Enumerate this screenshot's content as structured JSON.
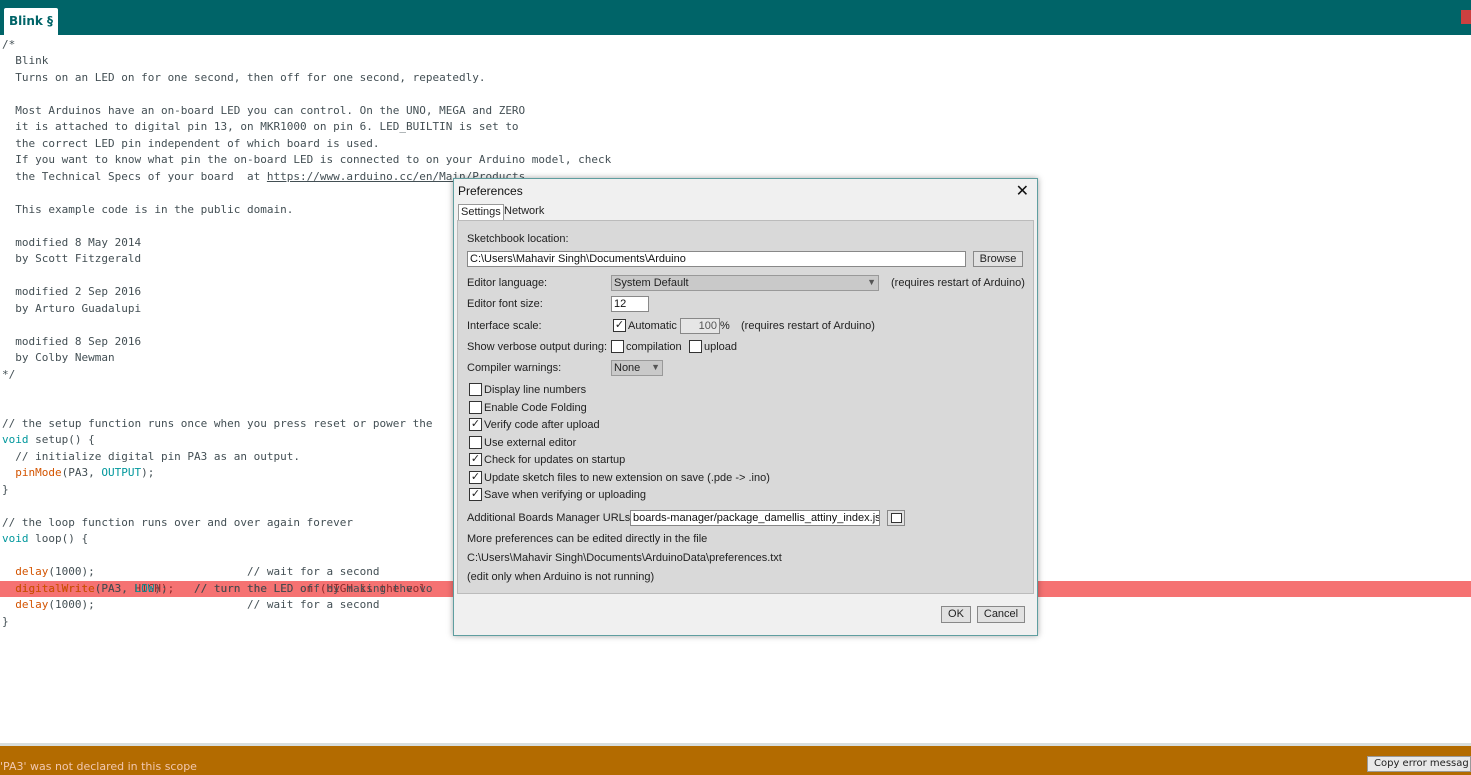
{
  "tab": {
    "label": "Blink §"
  },
  "code_lines": [
    "/*",
    "  Blink",
    "  Turns on an LED on for one second, then off for one second, repeatedly.",
    "",
    "  Most Arduinos have an on-board LED you can control. On the UNO, MEGA and ZERO",
    "  it is attached to digital pin 13, on MKR1000 on pin 6. LED_BUILTIN is set to",
    "  the correct LED pin independent of which board is used.",
    "  If you want to know what pin the on-board LED is connected to on your Arduino model, check",
    "  the Technical Specs of your board  at ",
    "",
    "  This example code is in the public domain.",
    "",
    "  modified 8 May 2014",
    "  by Scott Fitzgerald",
    "",
    "  modified 2 Sep 2016",
    "  by Arturo Guadalupi",
    "",
    "  modified 8 Sep 2016",
    "  by Colby Newman",
    "*/",
    "",
    "",
    "// the setup function runs once when you press reset or power the",
    "",
    "  // initialize digital pin PA3 as an output.",
    "",
    "}",
    "",
    "// the loop function runs over and over again forever",
    ""
  ],
  "code_url": "https://www.arduino.cc/en/Main/Products",
  "code_tokens": {
    "void": "void",
    "setup": " setup() {",
    "pinMode": "pinMode",
    "pinMode_args_1": "(PA3, ",
    "OUTPUT": "OUTPUT",
    "pinMode_args_2": ");",
    "loop": " loop() {",
    "dw_hl": "  digitalWrite(PA3, HIGH);   // turn the LED on (HIGH is the vol",
    "delay": "delay",
    "delay_arg_1": "(1000);                       // wait for a second",
    "digitalWrite": "digitalWrite",
    "dw_args_1": "(PA3, ",
    "LOW": "LOW",
    "dw_args_2": ");    // turn the LED off by making the vo",
    "delay_arg_2": "(1000);                       // wait for a second",
    "close_brace": "}"
  },
  "status": {
    "message": "'PA3' was not declared in this scope",
    "copy_button": "Copy error messag"
  },
  "dialog": {
    "title": "Preferences",
    "close": "✕",
    "tabs": [
      "Settings",
      "Network"
    ],
    "sketchbook_label": "Sketchbook location:",
    "sketchbook_value": "C:\\Users\\Mahavir Singh\\Documents\\Arduino",
    "browse": "Browse",
    "editor_language_label": "Editor language:",
    "editor_language_value": "System Default",
    "editor_language_note": "(requires restart of Arduino)",
    "font_size_label": "Editor font size:",
    "font_size_value": "12",
    "interface_scale_label": "Interface scale:",
    "automatic": "Automatic",
    "scale_value": "100",
    "percent": "%",
    "scale_note": "(requires restart of Arduino)",
    "verbose_label": "Show verbose output during:",
    "compilation": "compilation",
    "upload": "upload",
    "warnings_label": "Compiler warnings:",
    "warnings_value": "None",
    "checkboxes": [
      {
        "label": "Display line numbers",
        "checked": false
      },
      {
        "label": "Enable Code Folding",
        "checked": false
      },
      {
        "label": "Verify code after upload",
        "checked": true
      },
      {
        "label": "Use external editor",
        "checked": false
      },
      {
        "label": "Check for updates on startup",
        "checked": true
      },
      {
        "label": "Update sketch files to new extension on save (.pde -> .ino)",
        "checked": true
      },
      {
        "label": "Save when verifying or uploading",
        "checked": true
      }
    ],
    "boards_label": "Additional Boards Manager URLs:",
    "boards_value": "boards-manager/package_damellis_attiny_index.json",
    "more_prefs": "More preferences can be edited directly in the file",
    "prefs_path": "C:\\Users\\Mahavir Singh\\Documents\\ArduinoData\\preferences.txt",
    "edit_note": "(edit only when Arduino is not running)",
    "ok": "OK",
    "cancel": "Cancel"
  }
}
